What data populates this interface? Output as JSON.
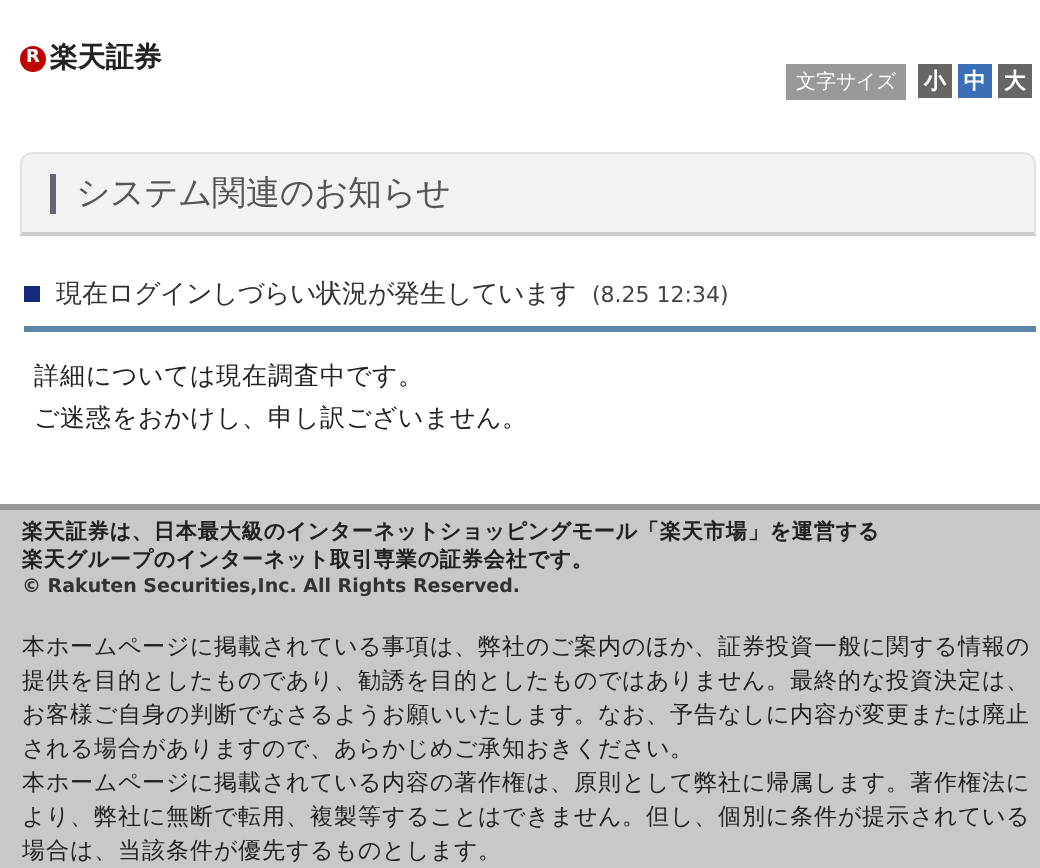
{
  "header": {
    "logo_mark": "R",
    "logo_text": "楽天証券",
    "font_size": {
      "label": "文字サイズ",
      "options": [
        {
          "label": "小",
          "selected": false
        },
        {
          "label": "中",
          "selected": true
        },
        {
          "label": "大",
          "selected": false
        }
      ]
    }
  },
  "notice": {
    "title": "システム関連のお知らせ",
    "heading": "現在ログインしづらい状況が発生しています",
    "timestamp": "(8.25 12:34)",
    "body": [
      "詳細については現在調査中です。",
      "ご迷惑をおかけし、申し訳ございません。"
    ]
  },
  "footer": {
    "company_lines": [
      "楽天証券は、日本最大級のインターネットショッピングモール「楽天市場」を運営する",
      "楽天グループのインターネット取引専業の証券会社です。"
    ],
    "copyright": "© Rakuten Securities,Inc. All Rights Reserved.",
    "disclaimers": [
      "本ホームページに掲載されている事項は、弊社のご案内のほか、証券投資一般に関する情報の提供を目的としたものであり、勧誘を目的としたものではありません。最終的な投資決定は、お客様ご自身の判断でなさるようお願いいたします。なお、予告なしに内容が変更または廃止される場合がありますので、あらかじめご承知おきください。",
      "本ホームページに掲載されている内容の著作権は、原則として弊社に帰属します。著作権法により、弊社に無断で転用、複製等することはできません。但し、個別に条件が提示されている場合は、当該条件が優先するものとします。"
    ]
  }
}
